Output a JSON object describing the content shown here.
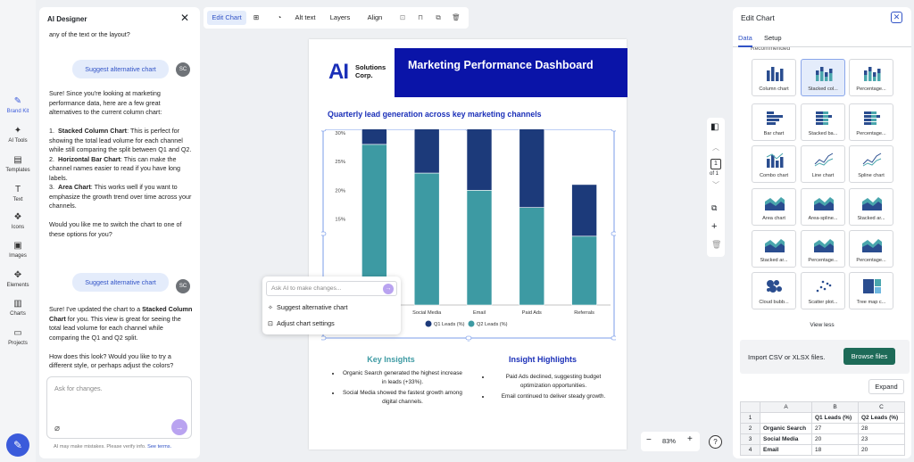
{
  "nav": {
    "items": [
      {
        "icon": "✎",
        "label": "Brand Kit",
        "name": "nav-brand-kit"
      },
      {
        "icon": "✦",
        "label": "AI Tools",
        "name": "nav-ai-tools"
      },
      {
        "icon": "▤",
        "label": "Templates",
        "name": "nav-templates"
      },
      {
        "icon": "T",
        "label": "Text",
        "name": "nav-text"
      },
      {
        "icon": "❖",
        "label": "Icons",
        "name": "nav-icons"
      },
      {
        "icon": "▣",
        "label": "Images",
        "name": "nav-images"
      },
      {
        "icon": "✥",
        "label": "Elements",
        "name": "nav-elements"
      },
      {
        "icon": "▥",
        "label": "Charts",
        "name": "nav-charts"
      },
      {
        "icon": "▭",
        "label": "Projects",
        "name": "nav-projects"
      }
    ]
  },
  "chat": {
    "title": "AI Designer",
    "intro_text": "any of the text or the layout?",
    "suggest_1": "Suggest alternative chart",
    "avatar": "SC",
    "reply_1_intro": "Sure! Since you're looking at marketing performance data, here are a few great alternatives to the current column chart:",
    "opt1_title": "Stacked Column Chart",
    "opt1_text": ": This is perfect for showing the total lead volume for each channel while still comparing the split between Q1 and Q2.",
    "opt2_title": "Horizontal Bar Chart",
    "opt2_text": ": This can make the channel names easier to read if you have long labels.",
    "opt3_title": "Area Chart",
    "opt3_text": ": This works well if you want to emphasize the growth trend over time across your channels.",
    "reply_1_outro": "Would you like me to switch the chart to one of these options for you?",
    "suggest_2": "Suggest alternative chart",
    "reply_2_a": "Sure! I've updated the chart to a ",
    "reply_2_b": "Stacked Column Chart",
    "reply_2_c": " for you. This view is great for seeing the total lead volume for each channel while comparing the Q1 and Q2 split.",
    "reply_2_outro": "How does this look? Would you like to try a different style, or perhaps adjust the colors?",
    "input_placeholder": "Ask for changes.",
    "disclaimer": "AI may make mistakes. Please verify info.",
    "see_terms": "See terms."
  },
  "toolbar": {
    "edit_chart": "Edit Chart",
    "alt_text": "Alt text",
    "layers": "Layers",
    "align": "Align"
  },
  "slide": {
    "logo_ai": "AI",
    "logo_name": "Solutions\nCorp.",
    "title": "Marketing Performance Dashboard",
    "chart_heading": "Quarterly lead generation across key marketing channels",
    "key_insights_title": "Key Insights",
    "key_insights": [
      "Organic Search generated the highest increase in leads (+33%).",
      "Social Media showed the fastest growth among digital channels."
    ],
    "insight_highlights_title": "Insight Highlights",
    "insight_highlights": [
      "Paid Ads declined, suggesting budget optimization opportunities.",
      "Email continued to deliver steady growth."
    ]
  },
  "chart_data": {
    "type": "bar",
    "stacked": true,
    "categories": [
      "Organic Search",
      "Social Media",
      "Email",
      "Paid Ads",
      "Referrals"
    ],
    "visible_category_labels": [
      "",
      "Social Media",
      "Email",
      "Paid Ads",
      "Referrals"
    ],
    "series": [
      {
        "name": "Q1 Leads (%)",
        "values": [
          27,
          20,
          18,
          25,
          9
        ],
        "color": "#1c3a7a"
      },
      {
        "name": "Q2 Leads (%)",
        "values": [
          28,
          23,
          20,
          17,
          12
        ],
        "color": "#3d9aa3"
      }
    ],
    "ytick_labels": [
      "30%",
      "25%",
      "20%",
      "15%"
    ],
    "ylim": [
      0,
      30
    ],
    "legend": "bottom",
    "grid": false
  },
  "ai_popup": {
    "placeholder": "Ask AI to make changes...",
    "item_1": "Suggest alternative chart",
    "item_2": "Adjust chart settings"
  },
  "page_nav": {
    "page": "1",
    "of": "of 1"
  },
  "zoom": {
    "minus": "−",
    "value": "83%",
    "plus": "+"
  },
  "help": "?",
  "edit_panel": {
    "title": "Edit Chart",
    "tab_data": "Data",
    "tab_setup": "Setup",
    "recommended": "Recommended",
    "chart_types": [
      "Column chart",
      "Stacked col...",
      "Percentage...",
      "Bar chart",
      "Stacked ba...",
      "Percentage...",
      "Combo chart",
      "Line chart",
      "Spline chart",
      "Area chart",
      "Area-spline...",
      "Stacked ar...",
      "Stacked ar...",
      "Percentage...",
      "Percentage...",
      "Cloud bubb...",
      "Scatter plot...",
      "Tree map c..."
    ],
    "view_less": "View less",
    "import_text": "Import CSV or XLSX files.",
    "browse": "Browse files",
    "expand": "Expand",
    "grid_cols": [
      "",
      "A",
      "B",
      "C"
    ],
    "grid_rows": [
      [
        "1",
        "",
        "Q1 Leads (%)",
        "Q2 Leads (%)"
      ],
      [
        "2",
        "Organic Search",
        "27",
        "28"
      ],
      [
        "3",
        "Social Media",
        "20",
        "23"
      ],
      [
        "4",
        "Email",
        "18",
        "20"
      ]
    ]
  }
}
